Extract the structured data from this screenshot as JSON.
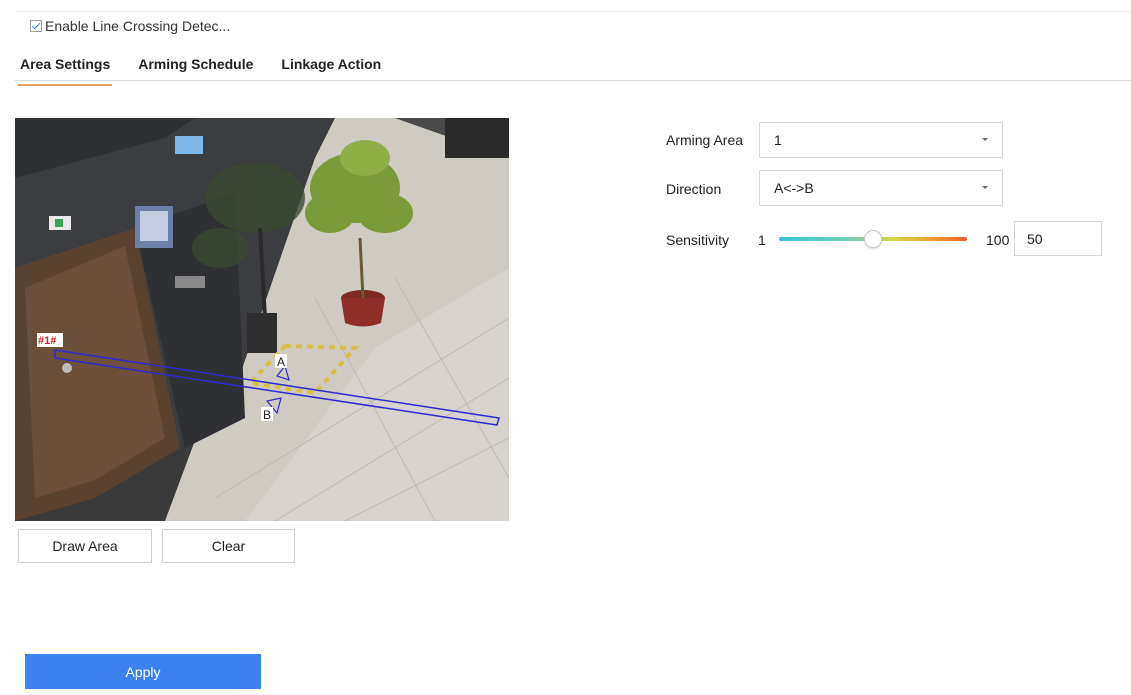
{
  "enable": {
    "label": "Enable Line Crossing Detec...",
    "checked": true
  },
  "tabs": [
    {
      "label": "Area Settings",
      "active": true
    },
    {
      "label": "Arming Schedule",
      "active": false
    },
    {
      "label": "Linkage Action",
      "active": false
    }
  ],
  "video": {
    "line_tag": "#1#",
    "direction_a": "A",
    "direction_b": "B"
  },
  "buttons": {
    "draw_area": "Draw Area",
    "clear": "Clear",
    "apply": "Apply"
  },
  "form": {
    "arming_area": {
      "label": "Arming Area",
      "value": "1"
    },
    "direction": {
      "label": "Direction",
      "value": "A<->B"
    },
    "sensitivity": {
      "label": "Sensitivity",
      "min": "1",
      "max": "100",
      "value": "50",
      "level": 0.5
    }
  },
  "colors": {
    "accent": "#3b82f0",
    "tab_underline": "#e8a56a",
    "line": "#2b2bd0"
  }
}
